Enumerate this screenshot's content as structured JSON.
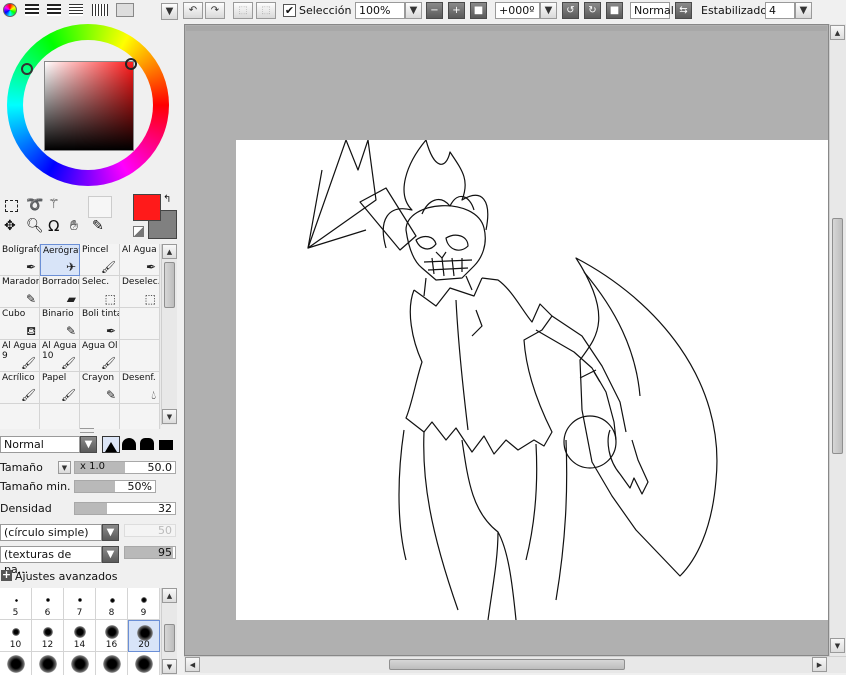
{
  "colors": {
    "primary": "#ff1a1a",
    "secondary": "#808080",
    "canvas_bg": "#b0b0b0",
    "selected_tool_bg": "#d8e4f8"
  },
  "toolbar": {
    "selection_label": "Selección",
    "selection_checked": true,
    "zoom": "100%",
    "rotation": "+000º",
    "blend_mode": "Normal",
    "stabilizer_label": "Estabilizador",
    "stabilizer_value": "4"
  },
  "tools": [
    {
      "name": "Bolígrafo",
      "short": "Bolígrafc",
      "icon": "pen-icon"
    },
    {
      "name": "Aerógrafo",
      "short": "Aerógraf",
      "icon": "airbrush-icon",
      "selected": true
    },
    {
      "name": "Pincel",
      "short": "Pincel",
      "icon": "brush-icon"
    },
    {
      "name": "Al Agua",
      "short": "Al Agua",
      "icon": "watercolor-icon"
    },
    {
      "name": "Marador",
      "short": "Marador",
      "icon": "marker-icon"
    },
    {
      "name": "Borrador",
      "short": "Borrador",
      "icon": "eraser-icon"
    },
    {
      "name": "Selec.",
      "short": "Selec.",
      "icon": "select-pen-icon"
    },
    {
      "name": "Deselec.",
      "short": "Deselec.",
      "icon": "deselect-pen-icon"
    },
    {
      "name": "Cubo",
      "short": "Cubo",
      "icon": "bucket-icon"
    },
    {
      "name": "Binario",
      "short": "Binario",
      "icon": "binary-pen-icon"
    },
    {
      "name": "Boli tinta",
      "short": "Boli tinta",
      "icon": "ink-pen-icon"
    },
    {
      "name": "",
      "short": "",
      "icon": ""
    },
    {
      "name": "Al Agua 9",
      "short": "Al Agua\n9",
      "icon": "brush-icon"
    },
    {
      "name": "Al Agua 10",
      "short": "Al Agua\n10",
      "icon": "brush-icon"
    },
    {
      "name": "Agua Ol",
      "short": "Agua Ol",
      "icon": "brush-icon"
    },
    {
      "name": "",
      "short": "",
      "icon": ""
    },
    {
      "name": "Acrílico",
      "short": "Acrílico",
      "icon": "brush-icon"
    },
    {
      "name": "Papel",
      "short": "Papel",
      "icon": "brush-icon"
    },
    {
      "name": "Crayon",
      "short": "Crayon",
      "icon": "crayon-icon"
    },
    {
      "name": "Desenf.",
      "short": "Desenf.",
      "icon": "blur-icon"
    }
  ],
  "brush": {
    "mode": "Normal",
    "size_label": "Tamaño",
    "size_multiplier": "x 1.0",
    "size_value": "50.0",
    "size_fraction": 0.5,
    "min_size_label": "Tamaño min.",
    "min_size_value": "50%",
    "min_size_fraction": 0.5,
    "density_label": "Densidad",
    "density_value": "32",
    "density_fraction": 0.32,
    "shape": "(círculo simple)",
    "shape_value": "50",
    "texture": "(texturas de pa...",
    "texture_value": "95",
    "advanced_label": "Ajustes avanzados"
  },
  "brush_sizes_row1": [
    "5",
    "6",
    "7",
    "8",
    "9"
  ],
  "brush_sizes_row2": [
    "10",
    "12",
    "14",
    "16",
    "20"
  ],
  "brush_sizes_selected": "20"
}
